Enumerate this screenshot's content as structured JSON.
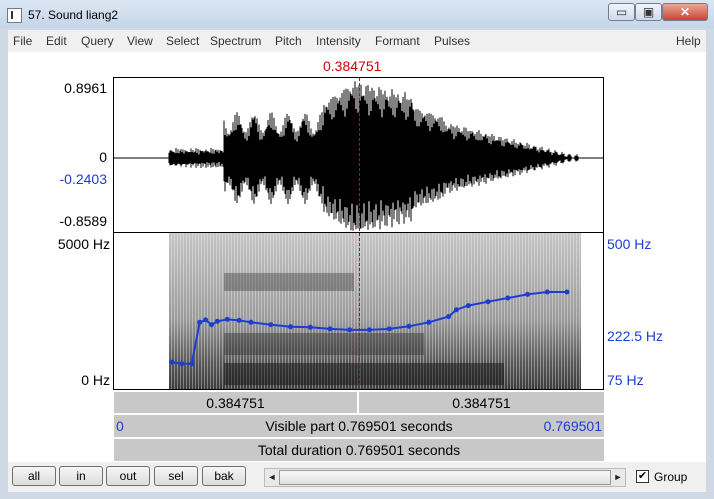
{
  "window": {
    "title": "57. Sound liang2",
    "minimize": "▭",
    "restore": "▣",
    "close": "✕"
  },
  "menu": [
    "File",
    "Edit",
    "Query",
    "View",
    "Select",
    "Spectrum",
    "Pitch",
    "Intensity",
    "Formant",
    "Pulses",
    "Help"
  ],
  "cursor": {
    "time_label": "0.384751",
    "color": "#d40000"
  },
  "waveform": {
    "y_max": "0.8961",
    "y_zero": "0",
    "y_cursor": "-0.2403",
    "y_min": "-0.8589"
  },
  "spectrogram": {
    "freq_top": "5000 Hz",
    "freq_bottom": "0 Hz"
  },
  "pitch": {
    "top": "500 Hz",
    "mid": "222.5 Hz",
    "bottom": "75 Hz",
    "color": "#1e3cd0"
  },
  "time_bar": {
    "left": "0.384751",
    "right": "0.384751"
  },
  "visible_bar": {
    "start": "0",
    "text": "Visible part 0.769501 seconds",
    "end": "0.769501"
  },
  "total_bar": {
    "text": "Total duration 0.769501 seconds"
  },
  "buttons": {
    "all": "all",
    "in": "in",
    "out": "out",
    "sel": "sel",
    "bak": "bak"
  },
  "scroll": {
    "left_arrow": "◄",
    "right_arrow": "►"
  },
  "group": {
    "label": "Group",
    "checked": true,
    "mark": "✔"
  },
  "pitch_curve": {
    "t": [
      0.0,
      0.025,
      0.05,
      0.07,
      0.085,
      0.1,
      0.115,
      0.14,
      0.17,
      0.2,
      0.25,
      0.3,
      0.35,
      0.4,
      0.45,
      0.5,
      0.55,
      0.6,
      0.65,
      0.7,
      0.72,
      0.75,
      0.8,
      0.85,
      0.9,
      0.95,
      1.0
    ],
    "hz": [
      105,
      103,
      103,
      170,
      175,
      165,
      172,
      176,
      174,
      170,
      165,
      161,
      160,
      157,
      155,
      155,
      157,
      162,
      170,
      182,
      198,
      208,
      218,
      228,
      238,
      245,
      245
    ]
  }
}
